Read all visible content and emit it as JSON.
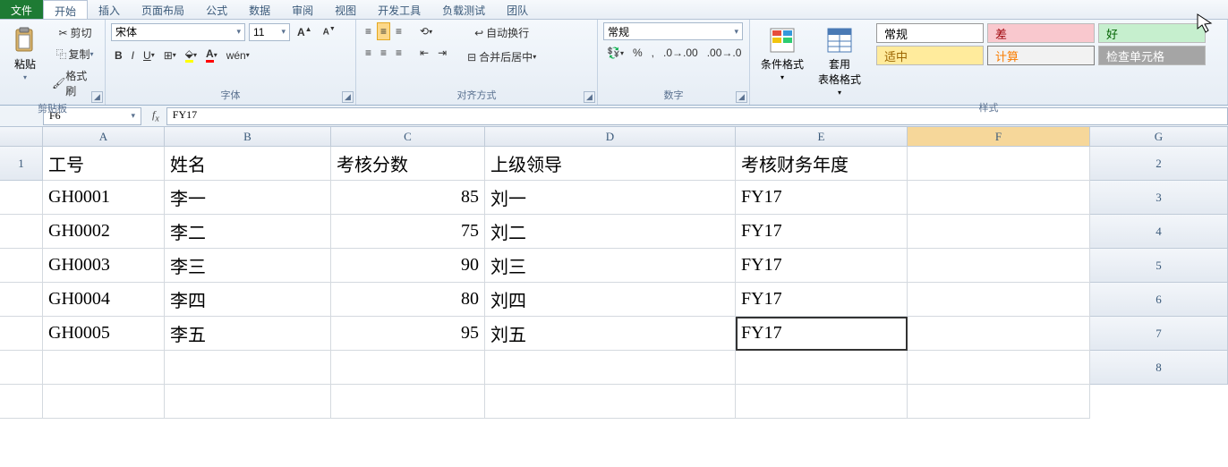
{
  "menu": {
    "file": "文件",
    "tabs": [
      "开始",
      "插入",
      "页面布局",
      "公式",
      "数据",
      "审阅",
      "视图",
      "开发工具",
      "负载测试",
      "团队"
    ]
  },
  "ribbon": {
    "clipboard": {
      "label": "剪贴板",
      "paste": "粘贴",
      "cut": "剪切",
      "copy": "复制",
      "format_painter": "格式刷"
    },
    "font": {
      "label": "字体",
      "name": "宋体",
      "size": "11"
    },
    "align": {
      "label": "对齐方式",
      "wrap": "自动换行",
      "merge": "合并后居中"
    },
    "number": {
      "label": "数字",
      "format": "常规"
    },
    "styles_group": {
      "label": "样式",
      "cond": "条件格式",
      "table": "套用\n表格格式"
    },
    "styles": {
      "normal": "常规",
      "bad": "差",
      "good": "好",
      "neutral": "适中",
      "calc": "计算",
      "check": "检查单元格"
    }
  },
  "formula_bar": {
    "cell_ref": "F6",
    "value": "FY17"
  },
  "columns": [
    "A",
    "B",
    "C",
    "D",
    "E",
    "F",
    "G"
  ],
  "header_row": [
    "",
    "工号",
    "姓名",
    "考核分数",
    "上级领导",
    "考核财务年度",
    ""
  ],
  "rows": [
    {
      "n": "1"
    },
    {
      "n": "2",
      "B": "GH0001",
      "C": "李一",
      "D": "85",
      "E": "刘一",
      "F": "FY17"
    },
    {
      "n": "3",
      "B": "GH0002",
      "C": "李二",
      "D": "75",
      "E": "刘二",
      "F": "FY17"
    },
    {
      "n": "4",
      "B": "GH0003",
      "C": "李三",
      "D": "90",
      "E": "刘三",
      "F": "FY17"
    },
    {
      "n": "5",
      "B": "GH0004",
      "C": "李四",
      "D": "80",
      "E": "刘四",
      "F": "FY17"
    },
    {
      "n": "6",
      "B": "GH0005",
      "C": "李五",
      "D": "95",
      "E": "刘五",
      "F": "FY17"
    },
    {
      "n": "7"
    },
    {
      "n": "8"
    }
  ],
  "active_cell": "F6"
}
